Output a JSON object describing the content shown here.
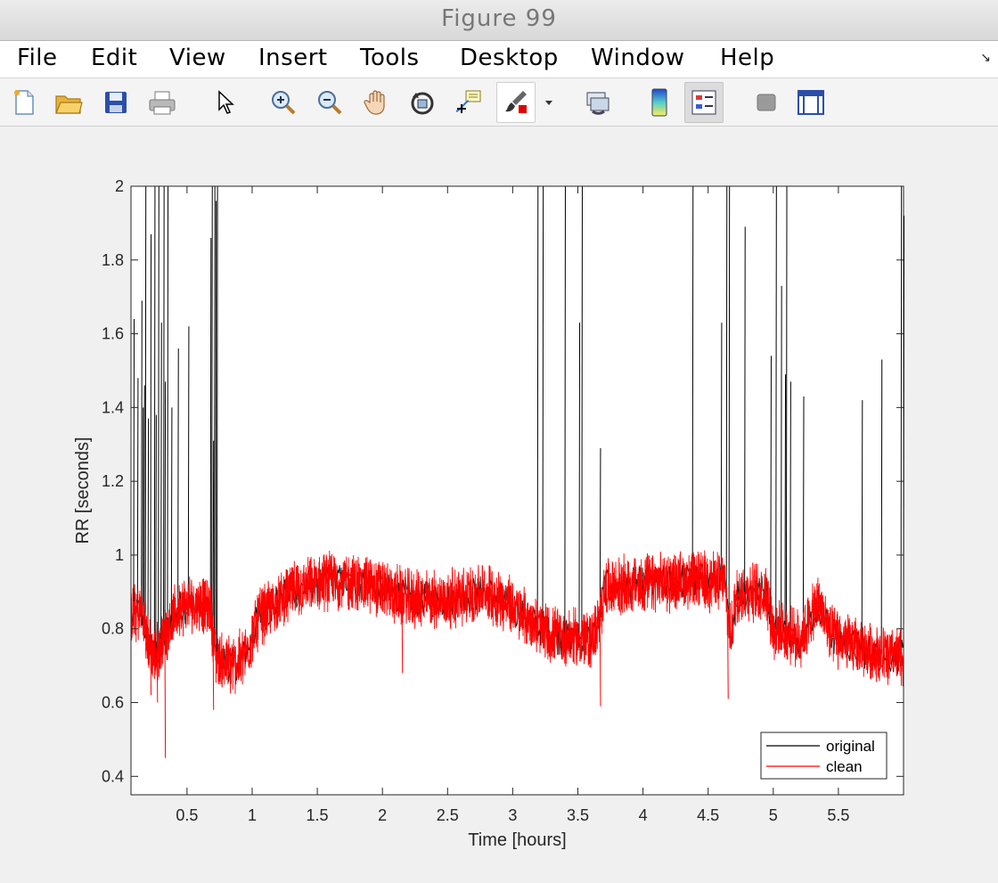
{
  "window": {
    "title": "Figure 99"
  },
  "menu": [
    "File",
    "Edit",
    "View",
    "Insert",
    "Tools",
    "Desktop",
    "Window",
    "Help"
  ],
  "toolbar": {
    "icons": [
      "new-figure-icon",
      "open-file-icon",
      "save-icon",
      "print-icon",
      "pointer-icon",
      "zoom-in-icon",
      "zoom-out-icon",
      "pan-hand-icon",
      "rotate-3d-icon",
      "data-cursor-icon",
      "brush-icon",
      "link-plot-icon",
      "colorbar-icon",
      "legend-icon",
      "hide-plot-tools-icon",
      "show-plot-tools-icon"
    ],
    "colors": {
      "brush": "#e00000",
      "colorbar_top": "#2244cc",
      "colorbar_bottom": "#ffee55"
    }
  },
  "chart_data": {
    "type": "line",
    "xlabel": "Time [hours]",
    "ylabel": "RR [seconds]",
    "xlim": [
      0.07,
      6.0
    ],
    "ylim": [
      0.35,
      2.0
    ],
    "xticks": [
      "0.5",
      "1",
      "1.5",
      "2",
      "2.5",
      "3",
      "3.5",
      "4",
      "4.5",
      "5",
      "5.5"
    ],
    "xtick_values": [
      0.5,
      1,
      1.5,
      2,
      2.5,
      3,
      3.5,
      4,
      4.5,
      5,
      5.5
    ],
    "yticks": [
      "0.4",
      "0.6",
      "0.8",
      "1",
      "1.2",
      "1.4",
      "1.6",
      "1.8",
      "2"
    ],
    "ytick_values": [
      0.4,
      0.6,
      0.8,
      1.0,
      1.2,
      1.4,
      1.6,
      1.8,
      2.0
    ],
    "grid": false,
    "legend": {
      "position": "bottom-right",
      "entries": [
        "original",
        "clean"
      ]
    },
    "series": [
      {
        "name": "original",
        "color": "#000000",
        "baseline": [
          [
            0.07,
            0.83
          ],
          [
            0.15,
            0.85
          ],
          [
            0.2,
            0.76
          ],
          [
            0.25,
            0.72
          ],
          [
            0.3,
            0.76
          ],
          [
            0.35,
            0.8
          ],
          [
            0.45,
            0.86
          ],
          [
            0.6,
            0.87
          ],
          [
            0.68,
            0.85
          ],
          [
            0.72,
            0.72
          ],
          [
            0.85,
            0.7
          ],
          [
            0.95,
            0.73
          ],
          [
            1.05,
            0.83
          ],
          [
            1.3,
            0.9
          ],
          [
            1.6,
            0.93
          ],
          [
            1.9,
            0.92
          ],
          [
            2.2,
            0.88
          ],
          [
            2.5,
            0.88
          ],
          [
            2.8,
            0.9
          ],
          [
            3.0,
            0.86
          ],
          [
            3.1,
            0.83
          ],
          [
            3.3,
            0.78
          ],
          [
            3.6,
            0.77
          ],
          [
            3.67,
            0.82
          ],
          [
            3.7,
            0.91
          ],
          [
            4.0,
            0.92
          ],
          [
            4.3,
            0.93
          ],
          [
            4.62,
            0.93
          ],
          [
            4.67,
            0.78
          ],
          [
            4.72,
            0.9
          ],
          [
            4.95,
            0.9
          ],
          [
            5.0,
            0.8
          ],
          [
            5.2,
            0.77
          ],
          [
            5.35,
            0.87
          ],
          [
            5.45,
            0.78
          ],
          [
            5.7,
            0.74
          ],
          [
            6.0,
            0.72
          ]
        ],
        "spikes": [
          [
            0.09,
            1.64
          ],
          [
            0.12,
            1.48
          ],
          [
            0.15,
            1.69
          ],
          [
            0.16,
            1.4
          ],
          [
            0.17,
            1.46
          ],
          [
            0.18,
            2.0
          ],
          [
            0.2,
            1.37
          ],
          [
            0.22,
            1.87
          ],
          [
            0.25,
            2.0
          ],
          [
            0.26,
            1.38
          ],
          [
            0.28,
            2.0
          ],
          [
            0.3,
            1.63
          ],
          [
            0.32,
            2.0
          ],
          [
            0.33,
            1.47
          ],
          [
            0.35,
            2.0
          ],
          [
            0.38,
            1.4
          ],
          [
            0.43,
            1.56
          ],
          [
            0.51,
            1.62
          ],
          [
            0.68,
            1.86
          ],
          [
            0.69,
            2.0
          ],
          [
            0.7,
            1.31
          ],
          [
            0.71,
            2.0
          ],
          [
            0.72,
            1.96
          ],
          [
            0.73,
            2.0
          ],
          [
            3.19,
            2.0
          ],
          [
            3.23,
            2.0
          ],
          [
            3.4,
            2.0
          ],
          [
            3.51,
            1.63
          ],
          [
            3.53,
            2.0
          ],
          [
            3.67,
            1.29
          ],
          [
            4.38,
            2.0
          ],
          [
            4.6,
            1.63
          ],
          [
            4.64,
            2.0
          ],
          [
            4.66,
            2.0
          ],
          [
            4.78,
            1.89
          ],
          [
            4.98,
            1.54
          ],
          [
            5.02,
            2.0
          ],
          [
            5.06,
            1.73
          ],
          [
            5.09,
            1.49
          ],
          [
            5.1,
            2.0
          ],
          [
            5.13,
            1.47
          ],
          [
            5.23,
            1.43
          ],
          [
            5.68,
            1.42
          ],
          [
            5.83,
            1.53
          ],
          [
            5.98,
            2.0
          ],
          [
            6.0,
            1.92
          ]
        ],
        "dips": [
          [
            0.2,
            0.66
          ],
          [
            0.33,
            0.45
          ],
          [
            0.7,
            0.58
          ],
          [
            2.15,
            0.68
          ],
          [
            3.67,
            0.59
          ],
          [
            4.65,
            0.61
          ]
        ]
      },
      {
        "name": "clean",
        "color": "#ff0000",
        "baseline": [
          [
            0.07,
            0.83
          ],
          [
            0.15,
            0.85
          ],
          [
            0.2,
            0.76
          ],
          [
            0.25,
            0.72
          ],
          [
            0.3,
            0.76
          ],
          [
            0.35,
            0.8
          ],
          [
            0.45,
            0.86
          ],
          [
            0.6,
            0.87
          ],
          [
            0.68,
            0.85
          ],
          [
            0.72,
            0.72
          ],
          [
            0.85,
            0.7
          ],
          [
            0.95,
            0.73
          ],
          [
            1.05,
            0.83
          ],
          [
            1.3,
            0.9
          ],
          [
            1.6,
            0.93
          ],
          [
            1.9,
            0.92
          ],
          [
            2.2,
            0.88
          ],
          [
            2.5,
            0.88
          ],
          [
            2.8,
            0.9
          ],
          [
            3.0,
            0.86
          ],
          [
            3.1,
            0.83
          ],
          [
            3.3,
            0.78
          ],
          [
            3.6,
            0.77
          ],
          [
            3.67,
            0.82
          ],
          [
            3.7,
            0.91
          ],
          [
            4.0,
            0.92
          ],
          [
            4.3,
            0.93
          ],
          [
            4.62,
            0.93
          ],
          [
            4.67,
            0.78
          ],
          [
            4.72,
            0.9
          ],
          [
            4.95,
            0.9
          ],
          [
            5.0,
            0.8
          ],
          [
            5.2,
            0.77
          ],
          [
            5.35,
            0.87
          ],
          [
            5.45,
            0.78
          ],
          [
            5.7,
            0.74
          ],
          [
            6.0,
            0.72
          ]
        ],
        "noise_amplitude": 0.07,
        "dips": [
          [
            0.22,
            0.62
          ],
          [
            0.27,
            0.6
          ],
          [
            0.33,
            0.45
          ],
          [
            0.7,
            0.58
          ],
          [
            2.15,
            0.68
          ],
          [
            3.67,
            0.59
          ],
          [
            4.65,
            0.61
          ]
        ]
      }
    ]
  }
}
